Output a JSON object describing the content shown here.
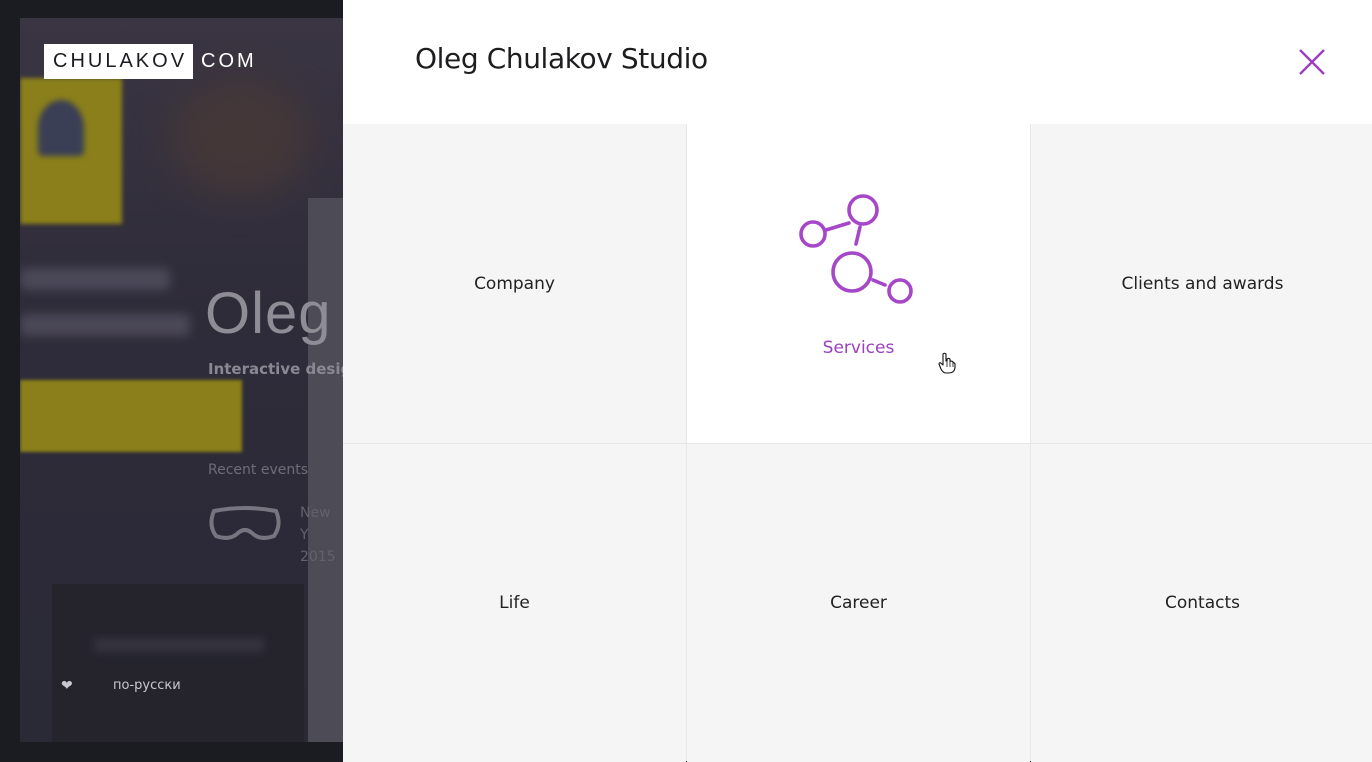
{
  "background": {
    "logo_box": "CHULAKOV",
    "logo_rest": "COM",
    "hero_title": "Oleg",
    "hero_subtitle": "Interactive design",
    "recent_label": "Recent events",
    "event_line1": "New Y",
    "event_line2": "2015",
    "language_link": "по-русски"
  },
  "menu": {
    "title": "Oleg Chulakov Studio",
    "tiles": [
      {
        "label": "Company"
      },
      {
        "label": "Services"
      },
      {
        "label": "Clients and awards"
      },
      {
        "label": "Life"
      },
      {
        "label": "Career"
      },
      {
        "label": "Contacts"
      }
    ]
  },
  "colors": {
    "accent": "#9b3fc0",
    "tile_bg": "#f5f5f5",
    "tile_active_bg": "#ffffff",
    "backdrop": "#1b1b22"
  },
  "icons": {
    "close": "close-icon",
    "services": "network-nodes-icon",
    "heart": "heart-icon",
    "goggles": "vr-goggles-icon",
    "cursor": "hand-pointer-cursor"
  }
}
